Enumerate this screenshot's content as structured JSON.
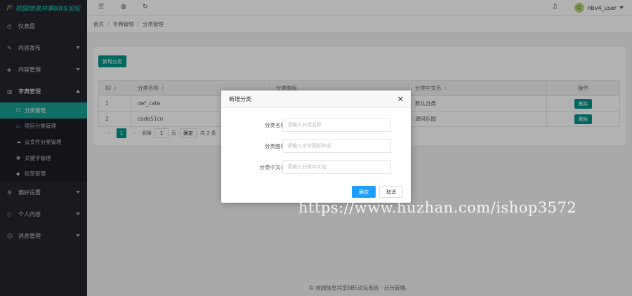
{
  "app": {
    "logo": "校园信息共享BBS论坛"
  },
  "sidebar": {
    "items": [
      {
        "label": "仪表盘",
        "icon": "dashboard-icon"
      },
      {
        "label": "内容发布",
        "icon": "edit-icon"
      },
      {
        "label": "内容管理",
        "icon": "layers-icon"
      },
      {
        "label": "字典管理",
        "icon": "book-icon"
      },
      {
        "label": "偏好设置",
        "icon": "settings-icon"
      },
      {
        "label": "个人内容",
        "icon": "diamond-icon"
      },
      {
        "label": "消息管理",
        "icon": "user-icon"
      }
    ],
    "dict_sub": [
      {
        "label": "分类管理"
      },
      {
        "label": "项目分类管理"
      },
      {
        "label": "云文件分类管理"
      },
      {
        "label": "关键字管理"
      },
      {
        "label": "标签管理"
      }
    ]
  },
  "topbar": {
    "username": "nbv4_user"
  },
  "breadcrumb": {
    "home": "首页",
    "level1": "字典管理",
    "level2": "分类管理"
  },
  "toolbar": {
    "add_label": "新增分类"
  },
  "table": {
    "headers": {
      "id": "ID",
      "name": "分类名称",
      "icon": "分类图标",
      "cn_name": "分类中文名",
      "ops": "操作"
    },
    "rows": [
      {
        "id": "1",
        "name": "def_cate",
        "cn_name": "默认分类",
        "delete": "删除"
      },
      {
        "id": "2",
        "name": "code51cn",
        "cn_name": "源码乐园",
        "delete": "删除"
      }
    ]
  },
  "pager": {
    "prev": "‹",
    "current": "1",
    "next": "›",
    "goto_label": "到第",
    "page_value": "1",
    "page_unit": "页",
    "confirm": "确定",
    "total": "共 2 条"
  },
  "footer": {
    "text": "© 校园信息共享BBS论坛系统 - 后台管理。"
  },
  "modal": {
    "title": "新增分类",
    "fields": [
      {
        "label": "分类名称",
        "placeholder": "请输入分类名称"
      },
      {
        "label": "分类图标",
        "placeholder": "请输入字体图标样式"
      },
      {
        "label": "分类中文名",
        "placeholder": "请输入分类中文名"
      }
    ],
    "ok": "确定",
    "cancel": "取消"
  },
  "watermark": "https://www.huzhan.com/ishop3572",
  "colors": {
    "primary": "#009688",
    "sidebar_bg": "#23262e",
    "ok_button": "#1e9fff"
  }
}
